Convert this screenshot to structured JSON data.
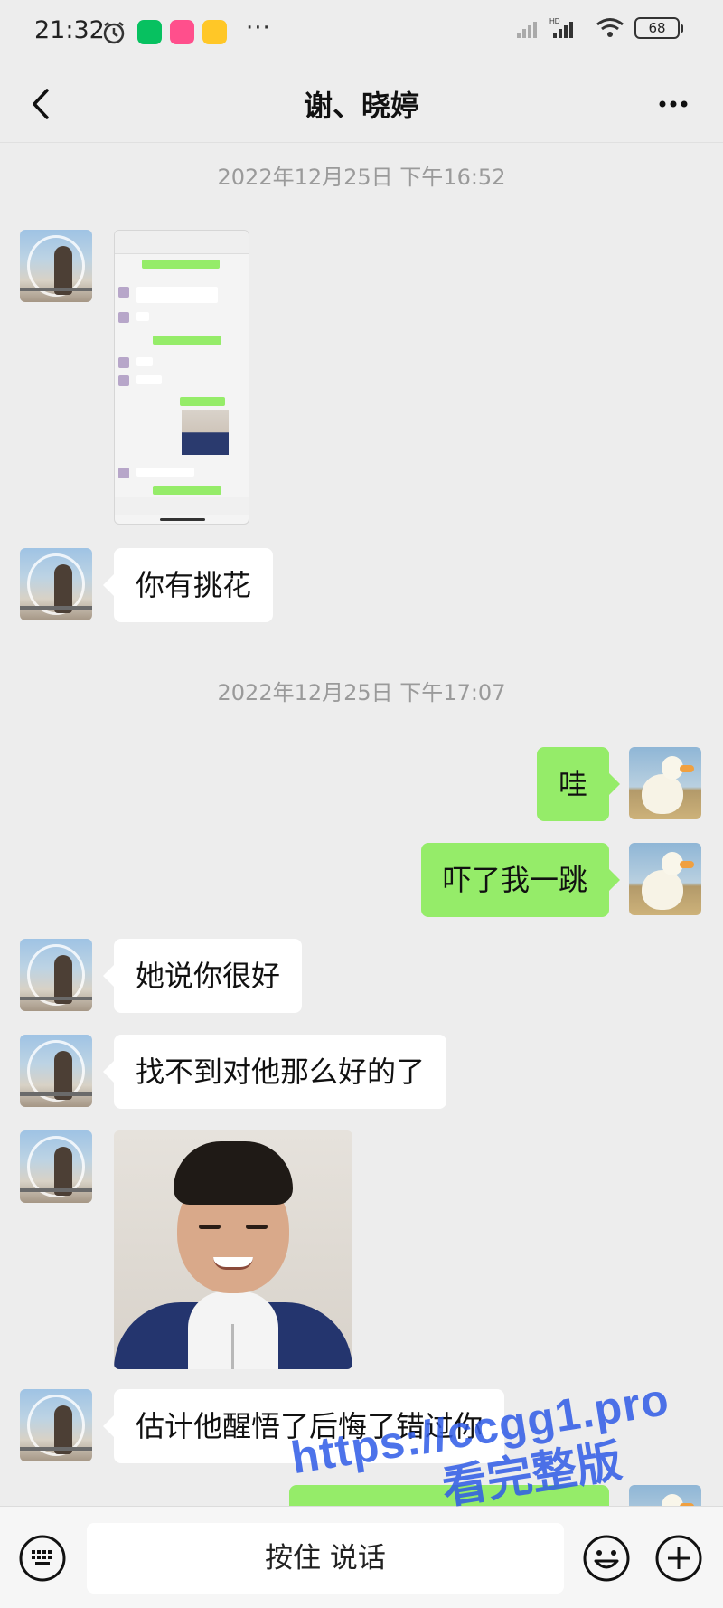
{
  "status_bar": {
    "time": "21:32",
    "battery": "68",
    "signal_label": "HD",
    "more": "···"
  },
  "nav": {
    "title": "谢、晓婷",
    "back_icon": "chevron-left-icon",
    "more_icon": "more-horizontal-icon"
  },
  "messages": {
    "timestamp_1": "2022年12月25日 下午16:52",
    "msg_2": "你有挑花",
    "timestamp_2": "2022年12月25日 下午17:07",
    "msg_3": "哇",
    "msg_4": "吓了我一跳",
    "msg_5": "她说你很好",
    "msg_6": "找不到对他那么好的了",
    "msg_8": "估计他醒悟了后悔了错过你"
  },
  "input_bar": {
    "hold_to_talk": "按住 说话",
    "voice_icon": "keyboard-icon",
    "emoji_icon": "emoji-icon",
    "plus_icon": "plus-circle-icon"
  },
  "watermark": {
    "line1": "https://ccgg1.pro",
    "line2": "看完整版"
  },
  "colors": {
    "background": "#ededed",
    "bubble_self": "#95ec69",
    "bubble_other": "#ffffff",
    "watermark": "#2f5be7"
  }
}
